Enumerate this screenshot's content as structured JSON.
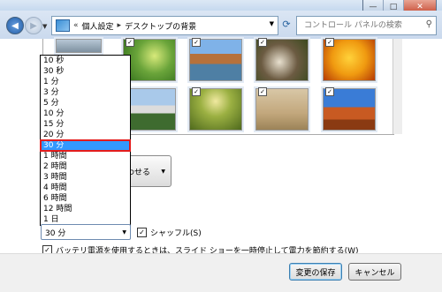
{
  "window": {
    "controls": {
      "minimize": "—",
      "maximize": "□",
      "close": "✕"
    }
  },
  "nav": {
    "breadcrumb": [
      "個人設定",
      "デスクトップの背景"
    ],
    "breadcrumb_prefix": "«",
    "search_placeholder": "コントロール パネルの検索"
  },
  "gallery": {
    "thumbnails": [
      {
        "name": "flowers-white",
        "checked": true
      },
      {
        "name": "green-leaves",
        "checked": true
      },
      {
        "name": "venice-canal",
        "checked": true
      },
      {
        "name": "ducklings",
        "checked": true
      },
      {
        "name": "tulips",
        "checked": true
      },
      {
        "name": "castle",
        "checked": true
      },
      {
        "name": "forest-path",
        "checked": true
      },
      {
        "name": "snail-beach",
        "checked": true
      },
      {
        "name": "desert-mesa",
        "checked": true
      }
    ]
  },
  "picture_position": {
    "label": "わせる"
  },
  "interval": {
    "options": [
      "10 秒",
      "30 秒",
      "1 分",
      "3 分",
      "5 分",
      "10 分",
      "15 分",
      "20 分",
      "30 分",
      "1 時間",
      "2 時間",
      "3 時間",
      "4 時間",
      "6 時間",
      "12 時間",
      "1 日"
    ],
    "selected": "30 分"
  },
  "shuffle": {
    "label": "シャッフル(S)",
    "checked": true
  },
  "battery": {
    "label": "バッテリ電源を使用するときは、スライド ショーを一時停止して電力を節約する(W)",
    "checked": true
  },
  "buttons": {
    "save": "変更の保存",
    "cancel": "キャンセル"
  },
  "colors": {
    "selection": "#3399ff",
    "highlight_box": "#e41c1c"
  }
}
